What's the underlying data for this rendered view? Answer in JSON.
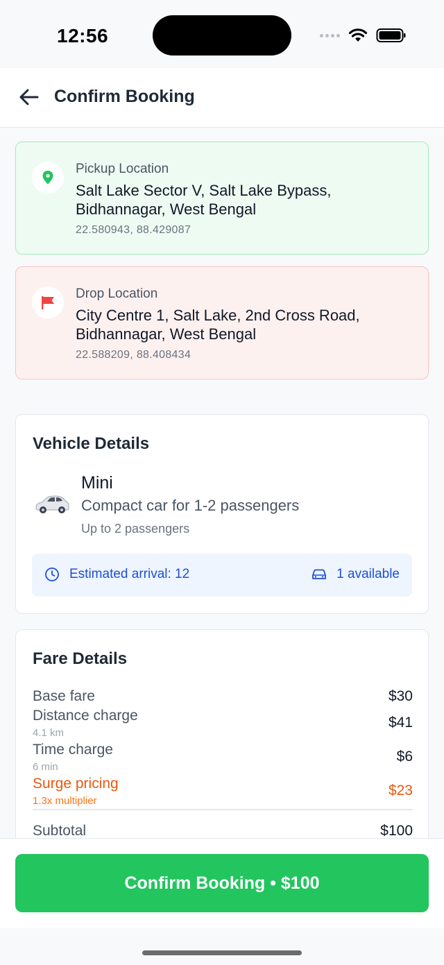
{
  "status_bar": {
    "time": "12:56"
  },
  "header": {
    "title": "Confirm Booking",
    "back_icon": "arrow-left-icon"
  },
  "pickup": {
    "label": "Pickup Location",
    "address": "Salt Lake Sector V, Salt Lake Bypass, Bidhannagar, West Bengal",
    "coords": "22.580943, 88.429087",
    "icon": "map-pin-icon",
    "accent": "#22c55e"
  },
  "drop": {
    "label": "Drop Location",
    "address": "City Centre 1, Salt Lake, 2nd Cross Road, Bidhannagar, West Bengal",
    "coords": "22.588209, 88.408434",
    "icon": "flag-icon",
    "accent": "#ef4444"
  },
  "vehicle": {
    "section_title": "Vehicle Details",
    "name": "Mini",
    "description": "Compact car for 1-2 passengers",
    "capacity": "Up to 2 passengers",
    "eta_text": "Estimated arrival: 12",
    "available_text": "1 available"
  },
  "fare": {
    "section_title": "Fare Details",
    "rows": [
      {
        "label": "Base fare",
        "sub": "",
        "amount": "$30"
      },
      {
        "label": "Distance charge",
        "sub": "4.1 km",
        "amount": "$41"
      },
      {
        "label": "Time charge",
        "sub": "6 min",
        "amount": "$6"
      },
      {
        "label": "Surge pricing",
        "sub": "1.3x multiplier",
        "amount": "$23"
      }
    ],
    "subtotal_label": "Subtotal",
    "subtotal_amount": "$100"
  },
  "confirm_button": {
    "label": "Confirm Booking • $100"
  },
  "colors": {
    "primary": "#22c55e",
    "surge": "#ea580c",
    "info": "#1d4ed8"
  }
}
